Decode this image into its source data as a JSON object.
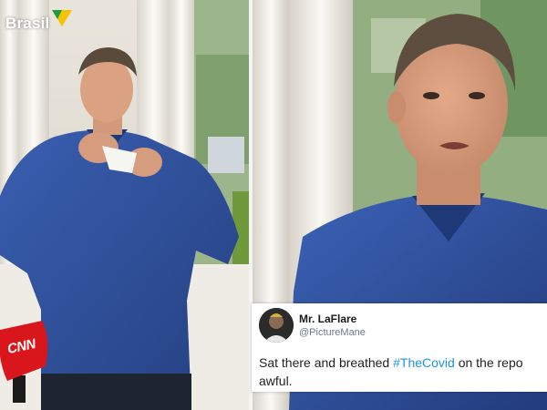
{
  "watermark": {
    "text": "Brasil",
    "logo_icon": "brasil-flag-logo-icon"
  },
  "microphone": {
    "label": "CNN",
    "color": "#d9161b"
  },
  "tweet": {
    "display_name": "Mr. LaFlare",
    "handle": "@PictureMane",
    "text_before": "Sat there and breathed ",
    "hashtag": "#TheCovid",
    "text_after": " on the repo",
    "text_line2": "awful.",
    "hashtag_color": "#1b95e0"
  },
  "colors": {
    "shirt": "#2e4f9c",
    "pillar": "#f2efe8"
  }
}
